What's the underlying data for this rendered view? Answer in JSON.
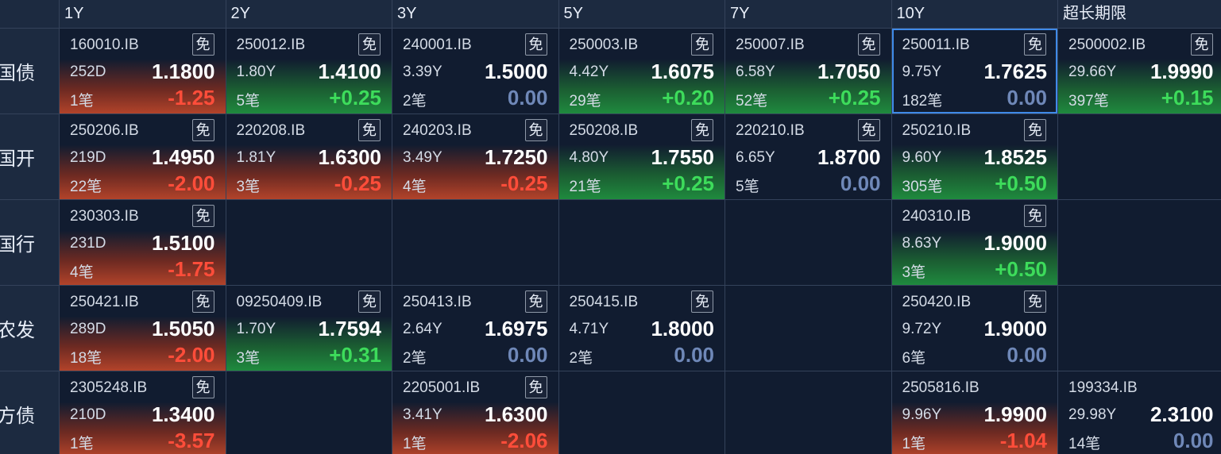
{
  "columns": [
    "1Y",
    "2Y",
    "3Y",
    "5Y",
    "7Y",
    "10Y",
    "超长期限"
  ],
  "mian_label": "免",
  "rows": [
    {
      "label": "国债",
      "cells": [
        {
          "code": "160010.IB",
          "mian": true,
          "term": "252D",
          "yield": "1.1800",
          "count": "1笔",
          "change": "-1.25",
          "trend": "down"
        },
        {
          "code": "250012.IB",
          "mian": true,
          "term": "1.80Y",
          "yield": "1.4100",
          "count": "5笔",
          "change": "+0.25",
          "trend": "up"
        },
        {
          "code": "240001.IB",
          "mian": true,
          "term": "3.39Y",
          "yield": "1.5000",
          "count": "2笔",
          "change": "0.00",
          "trend": "flat"
        },
        {
          "code": "250003.IB",
          "mian": true,
          "term": "4.42Y",
          "yield": "1.6075",
          "count": "29笔",
          "change": "+0.20",
          "trend": "up"
        },
        {
          "code": "250007.IB",
          "mian": true,
          "term": "6.58Y",
          "yield": "1.7050",
          "count": "52笔",
          "change": "+0.25",
          "trend": "up"
        },
        {
          "code": "250011.IB",
          "mian": true,
          "term": "9.75Y",
          "yield": "1.7625",
          "count": "182笔",
          "change": "0.00",
          "trend": "flat",
          "selected": true
        },
        {
          "code": "2500002.IB",
          "mian": true,
          "term": "29.66Y",
          "yield": "1.9990",
          "count": "397笔",
          "change": "+0.15",
          "trend": "up"
        }
      ]
    },
    {
      "label": "国开",
      "cells": [
        {
          "code": "250206.IB",
          "mian": true,
          "term": "219D",
          "yield": "1.4950",
          "count": "22笔",
          "change": "-2.00",
          "trend": "down"
        },
        {
          "code": "220208.IB",
          "mian": true,
          "term": "1.81Y",
          "yield": "1.6300",
          "count": "3笔",
          "change": "-0.25",
          "trend": "down"
        },
        {
          "code": "240203.IB",
          "mian": true,
          "term": "3.49Y",
          "yield": "1.7250",
          "count": "4笔",
          "change": "-0.25",
          "trend": "down"
        },
        {
          "code": "250208.IB",
          "mian": true,
          "term": "4.80Y",
          "yield": "1.7550",
          "count": "21笔",
          "change": "+0.25",
          "trend": "up"
        },
        {
          "code": "220210.IB",
          "mian": true,
          "term": "6.65Y",
          "yield": "1.8700",
          "count": "5笔",
          "change": "0.00",
          "trend": "flat"
        },
        {
          "code": "250210.IB",
          "mian": true,
          "term": "9.60Y",
          "yield": "1.8525",
          "count": "305笔",
          "change": "+0.50",
          "trend": "up"
        },
        null
      ]
    },
    {
      "label": "国行",
      "cells": [
        {
          "code": "230303.IB",
          "mian": true,
          "term": "231D",
          "yield": "1.5100",
          "count": "4笔",
          "change": "-1.75",
          "trend": "down"
        },
        null,
        null,
        null,
        null,
        {
          "code": "240310.IB",
          "mian": true,
          "term": "8.63Y",
          "yield": "1.9000",
          "count": "3笔",
          "change": "+0.50",
          "trend": "up"
        },
        null
      ]
    },
    {
      "label": "农发",
      "cells": [
        {
          "code": "250421.IB",
          "mian": true,
          "term": "289D",
          "yield": "1.5050",
          "count": "18笔",
          "change": "-2.00",
          "trend": "down"
        },
        {
          "code": "09250409.IB",
          "mian": true,
          "term": "1.70Y",
          "yield": "1.7594",
          "count": "3笔",
          "change": "+0.31",
          "trend": "up"
        },
        {
          "code": "250413.IB",
          "mian": true,
          "term": "2.64Y",
          "yield": "1.6975",
          "count": "2笔",
          "change": "0.00",
          "trend": "flat"
        },
        {
          "code": "250415.IB",
          "mian": true,
          "term": "4.71Y",
          "yield": "1.8000",
          "count": "2笔",
          "change": "0.00",
          "trend": "flat"
        },
        null,
        {
          "code": "250420.IB",
          "mian": true,
          "term": "9.72Y",
          "yield": "1.9000",
          "count": "6笔",
          "change": "0.00",
          "trend": "flat"
        },
        null
      ]
    },
    {
      "label": "地方债",
      "cells": [
        {
          "code": "2305248.IB",
          "mian": true,
          "term": "210D",
          "yield": "1.3400",
          "count": "1笔",
          "change": "-3.57",
          "trend": "down"
        },
        null,
        {
          "code": "2205001.IB",
          "mian": true,
          "term": "3.41Y",
          "yield": "1.6300",
          "count": "1笔",
          "change": "-2.06",
          "trend": "down"
        },
        null,
        null,
        {
          "code": "2505816.IB",
          "mian": false,
          "term": "9.96Y",
          "yield": "1.9900",
          "count": "1笔",
          "change": "-1.04",
          "trend": "down"
        },
        {
          "code": "199334.IB",
          "mian": false,
          "term": "29.98Y",
          "yield": "2.3100",
          "count": "14笔",
          "change": "0.00",
          "trend": "flat"
        }
      ]
    }
  ],
  "colors": {
    "background": "#111c30",
    "header": "#1c2a40",
    "up_fill": "#1f8a3e",
    "down_fill": "#b2432a",
    "positive_text": "#3ddc5b",
    "negative_text": "#ff4d3a",
    "zero_text": "#6f88b8",
    "selected_border": "#3f8ae8"
  }
}
